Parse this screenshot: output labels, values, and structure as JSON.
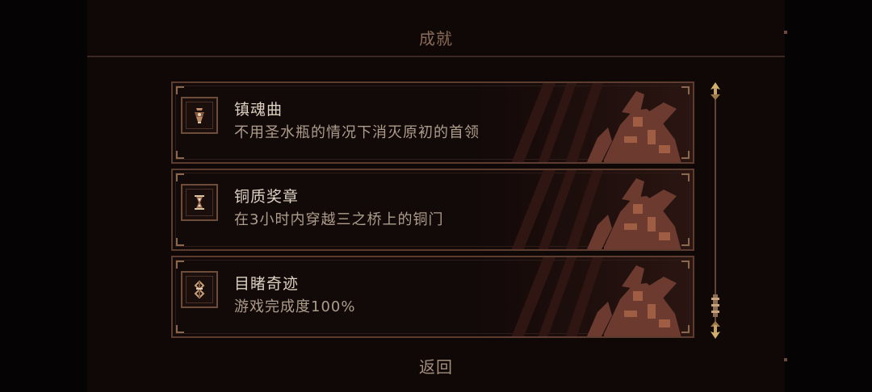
{
  "screen": {
    "title": "成就",
    "back_label": "返回"
  },
  "achievements": [
    {
      "name": "镇魂曲",
      "description": "不用圣水瓶的情况下消灭原初的首领",
      "icon": "urn-icon"
    },
    {
      "name": "铜质奖章",
      "description": "在3小时内穿越三之桥上的铜门",
      "icon": "hourglass-icon"
    },
    {
      "name": "目睹奇迹",
      "description": "游戏完成度100%",
      "icon": "rune-icon"
    }
  ],
  "colors": {
    "panel": "#0f0807",
    "frame": "#5b3c2f",
    "gold": "#c8a36c",
    "title": "#8a6b55",
    "text": "#dfd2c2",
    "subtext": "#ae9d8a"
  }
}
